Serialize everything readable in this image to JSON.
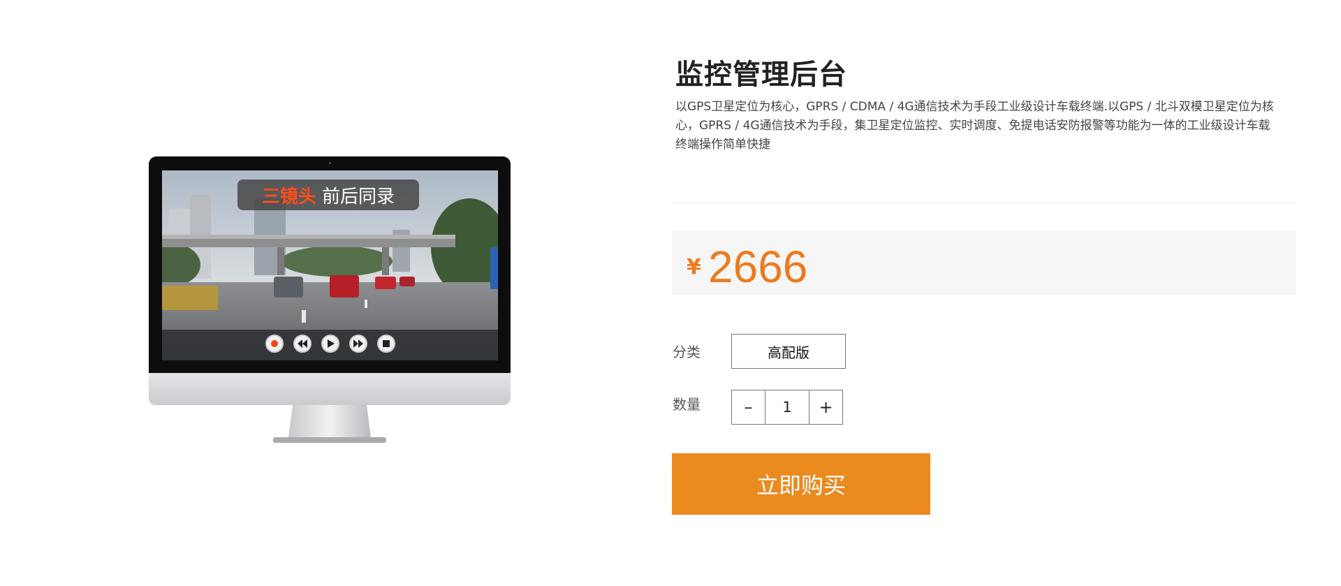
{
  "product": {
    "title": "监控管理后台",
    "description": "以GPS卫星定位为核心，GPRS / CDMA / 4G通信技术为手段工业级设计车载终端.以GPS / 北斗双模卫星定位为核心，GPRS  /  4G通信技术为手段，集卫星定位监控、实时调度、免提电话安防报警等功能为一体的工业级设计车载终端操作简单快捷",
    "image": {
      "overlay_strong": "三镜头",
      "overlay_text": "前后同录",
      "controls": [
        "record-icon",
        "rewind-icon",
        "play-icon",
        "fast-forward-icon",
        "stop-icon"
      ]
    }
  },
  "price": {
    "currency": "¥",
    "amount": "2666",
    "color": "#ec7a1f"
  },
  "options": {
    "category_label": "分类",
    "category_value": "高配版",
    "quantity_label": "数量",
    "quantity_decrement": "–",
    "quantity_value": "1",
    "quantity_increment": "+"
  },
  "actions": {
    "buy_now": "立即购买",
    "buy_color": "#eb8a1f"
  }
}
